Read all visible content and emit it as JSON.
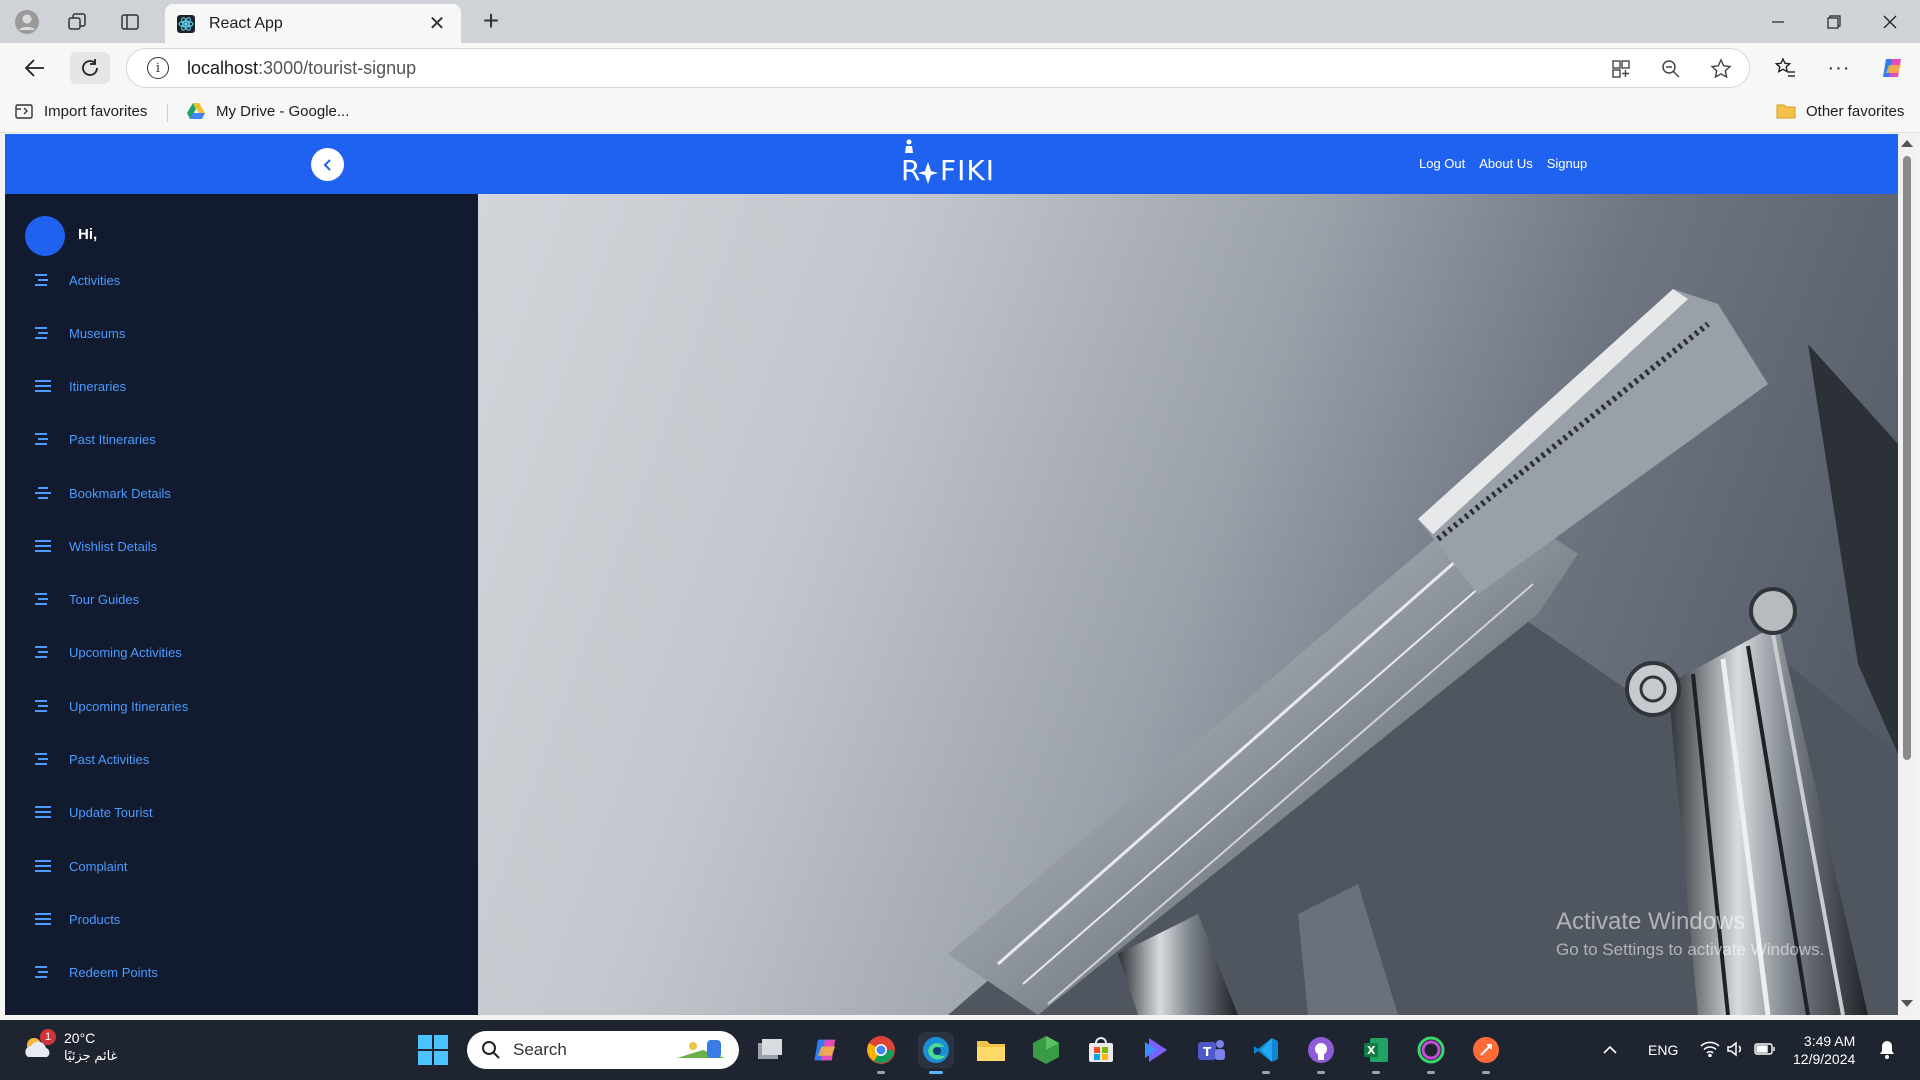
{
  "browser": {
    "tab_title": "React App",
    "url_host": "localhost",
    "url_path": ":3000/tourist-signup",
    "favorites": [
      {
        "label": "Import favorites"
      },
      {
        "label": "My Drive - Google..."
      },
      {
        "label": "Other favorites"
      }
    ]
  },
  "app": {
    "brand_left": "R",
    "brand_right": "FIKI",
    "nav": [
      "Log Out",
      "About Us",
      "Signup"
    ],
    "greeting": "Hi,",
    "sidebar_items": [
      "Activities",
      "Museums",
      "Itineraries",
      "Past Itineraries",
      "Bookmark Details",
      "Wishlist Details",
      "Tour Guides",
      "Upcoming Activities",
      "Upcoming Itineraries",
      "Past Activities",
      "Update Tourist",
      "Complaint",
      "Products",
      "Redeem Points"
    ],
    "colors": {
      "header": "#1f62f0",
      "sidebar": "#111a2e",
      "link": "#4c9bff"
    }
  },
  "watermark": {
    "line1": "Activate Windows",
    "line2": "Go to Settings to activate Windows."
  },
  "taskbar": {
    "weather_badge": "1",
    "temperature": "20°C",
    "condition": "غائم جزئيًا",
    "search_label": "Search",
    "language": "ENG",
    "time": "3:49 AM",
    "date": "12/9/2024"
  }
}
